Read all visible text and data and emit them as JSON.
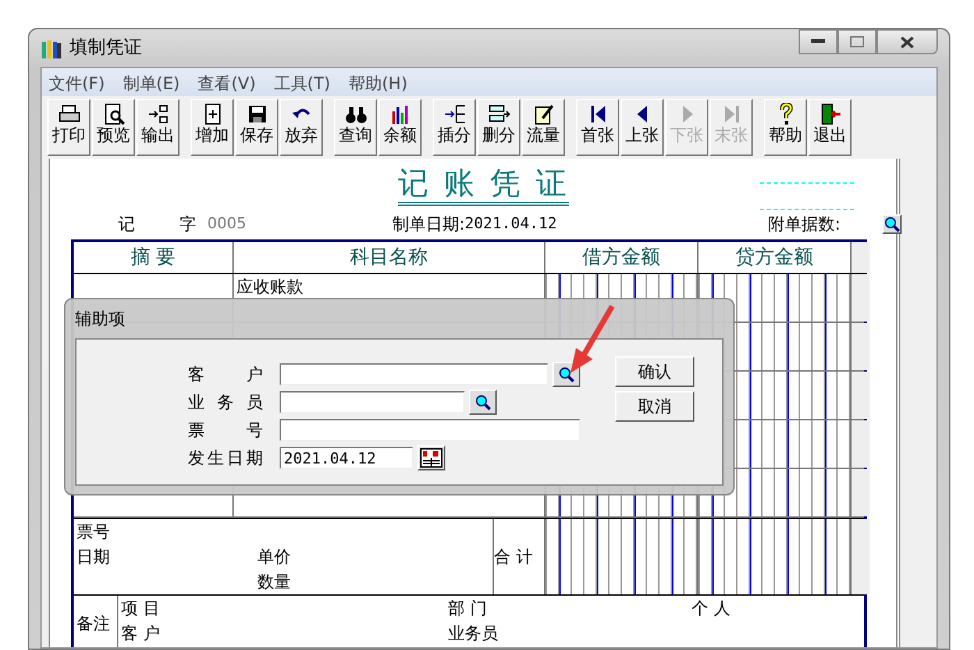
{
  "window": {
    "title": "填制凭证"
  },
  "menu": [
    "文件(F)",
    "制单(E)",
    "查看(V)",
    "工具(T)",
    "帮助(H)"
  ],
  "toolbar_groups": [
    [
      {
        "label": "打印",
        "disabled": false
      },
      {
        "label": "预览",
        "disabled": false
      },
      {
        "label": "输出",
        "disabled": false
      }
    ],
    [
      {
        "label": "增加",
        "disabled": false
      },
      {
        "label": "保存",
        "disabled": false
      },
      {
        "label": "放弃",
        "disabled": false
      }
    ],
    [
      {
        "label": "查询",
        "disabled": false
      },
      {
        "label": "余额",
        "disabled": false
      }
    ],
    [
      {
        "label": "插分",
        "disabled": false
      },
      {
        "label": "删分",
        "disabled": false
      },
      {
        "label": "流量",
        "disabled": false
      }
    ],
    [
      {
        "label": "首张",
        "disabled": false
      },
      {
        "label": "上张",
        "disabled": false
      },
      {
        "label": "下张",
        "disabled": true
      },
      {
        "label": "末张",
        "disabled": true
      }
    ],
    [
      {
        "label": "帮助",
        "disabled": false
      },
      {
        "label": "退出",
        "disabled": false
      }
    ]
  ],
  "voucher": {
    "title": "记 账 凭 证",
    "type": "记",
    "type_suffix": "字",
    "number": "0005",
    "date_label": "制单日期:",
    "date": "2021.04.12",
    "attachments_label": "附单据数:"
  },
  "table": {
    "columns": [
      "摘 要",
      "科目名称",
      "借方金额",
      "贷方金额"
    ],
    "rows": [
      {
        "account": "应收账款"
      }
    ]
  },
  "footer": {
    "ticket_label": "票号",
    "date_label": "日期",
    "price_label": "单价",
    "quantity_label": "数量",
    "total_label": "合 计"
  },
  "notes": {
    "label": "备注",
    "fields": [
      "项 目",
      "客 户",
      "部 门",
      "业务员",
      "个 人"
    ]
  },
  "dialog": {
    "title": "辅助项",
    "fields": [
      {
        "label": "客 户",
        "kind": "lookup"
      },
      {
        "label": "业 务 员",
        "kind": "lookup"
      },
      {
        "label": "票 号",
        "kind": "text"
      },
      {
        "label": "发生日期",
        "kind": "date",
        "value": "2021.04.12"
      }
    ],
    "buttons": [
      "确认",
      "取消"
    ]
  }
}
